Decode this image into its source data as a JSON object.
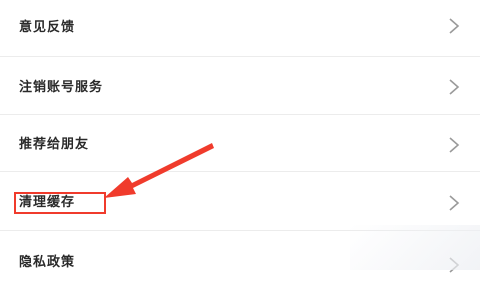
{
  "settings": {
    "items": [
      {
        "label": "意见反馈"
      },
      {
        "label": "注销账号服务"
      },
      {
        "label": "推荐给朋友"
      },
      {
        "label": "清理缓存"
      },
      {
        "label": "隐私政策"
      }
    ]
  },
  "annotation": {
    "color": "#f03b2c",
    "target": "清理缓存"
  },
  "icons": {
    "chevron": "chevron-right-icon"
  }
}
